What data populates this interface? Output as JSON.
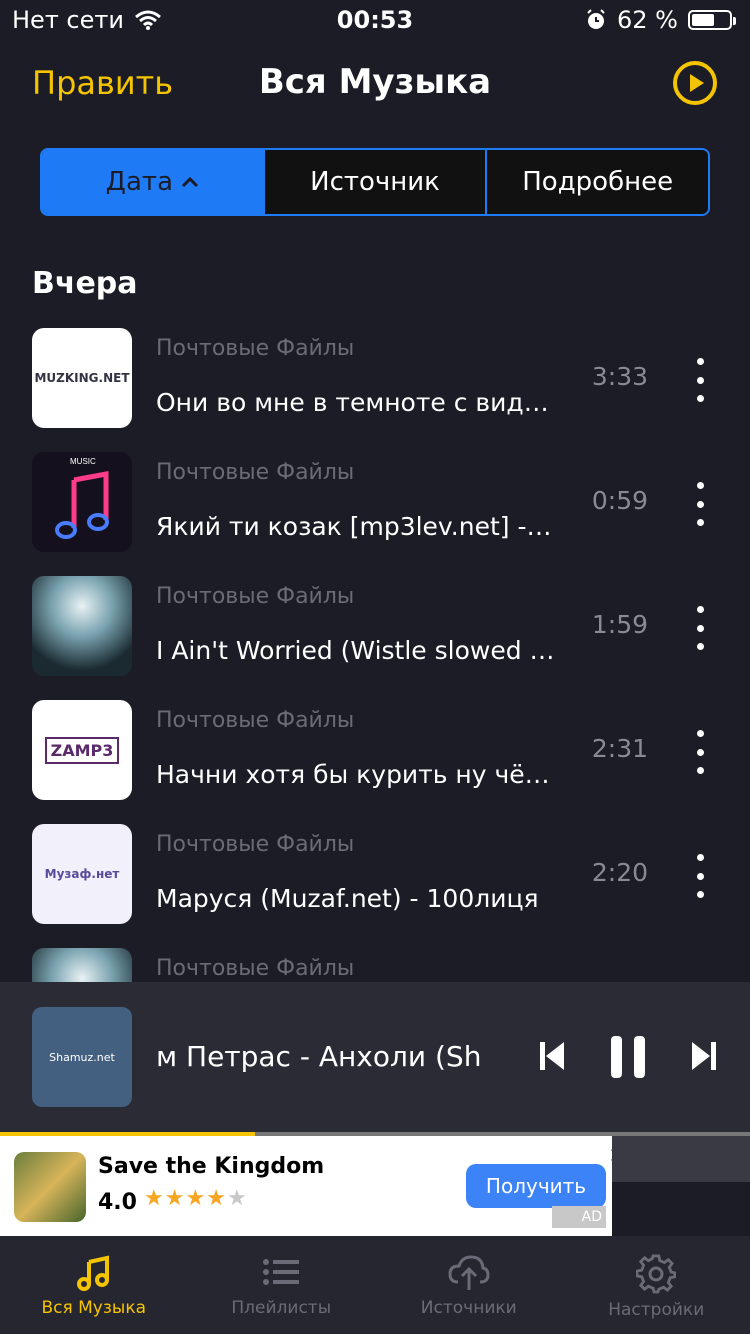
{
  "status_bar": {
    "carrier": "Нет сети",
    "time": "00:53",
    "battery_percent": "62 %",
    "battery_level": 0.62
  },
  "nav": {
    "edit_label": "Править",
    "title": "Вся Музыка",
    "play_icon": "play-circle-icon"
  },
  "segments": [
    {
      "label": "Дата",
      "active": true,
      "indicator": "chevron-up-icon"
    },
    {
      "label": "Источник",
      "active": false
    },
    {
      "label": "Подробнее",
      "active": false
    }
  ],
  "section": {
    "title": "Вчера"
  },
  "tracks": [
    {
      "source": "Почтовые Файлы",
      "title": "Они во мне в темноте с виду…",
      "duration": "3:33",
      "artwork": "MUZKING.NET"
    },
    {
      "source": "Почтовые Файлы",
      "title": "Який ти козак [mp3lev.net] -…",
      "duration": "0:59",
      "artwork": "MUSIC"
    },
    {
      "source": "Почтовые Файлы",
      "title": "I Ain't Worried (Wistle slowed r…",
      "duration": "1:59",
      "artwork": ""
    },
    {
      "source": "Почтовые Файлы",
      "title": "Начни хотя бы курить ну чё т…",
      "duration": "2:31",
      "artwork": "ZAMP3"
    },
    {
      "source": "Почтовые Файлы",
      "title": "Маруся (Muzaf.net) - 100лиця",
      "duration": "2:20",
      "artwork": "Музаф.нет"
    },
    {
      "source": "Почтовые Файлы",
      "title": "",
      "duration": "",
      "artwork": ""
    }
  ],
  "player": {
    "artwork": "Shamuz.net",
    "title": "м Петрас - Анхоли (Sh",
    "progress": 0.34
  },
  "ad": {
    "app_name": "Save the Kingdom",
    "rating": "4.0",
    "stars_filled": 4,
    "button_label": "Получить",
    "badge": "AD",
    "close_icon": "close-icon"
  },
  "tabs": [
    {
      "label": "Вся Музыка",
      "icon": "music-note-icon",
      "active": true
    },
    {
      "label": "Плейлисты",
      "icon": "list-icon",
      "active": false
    },
    {
      "label": "Источники",
      "icon": "cloud-upload-icon",
      "active": false
    },
    {
      "label": "Настройки",
      "icon": "gear-icon",
      "active": false
    }
  ],
  "colors": {
    "accent": "#f5c400",
    "segment_blue": "#1e7bf5",
    "background": "#1c1c27"
  }
}
